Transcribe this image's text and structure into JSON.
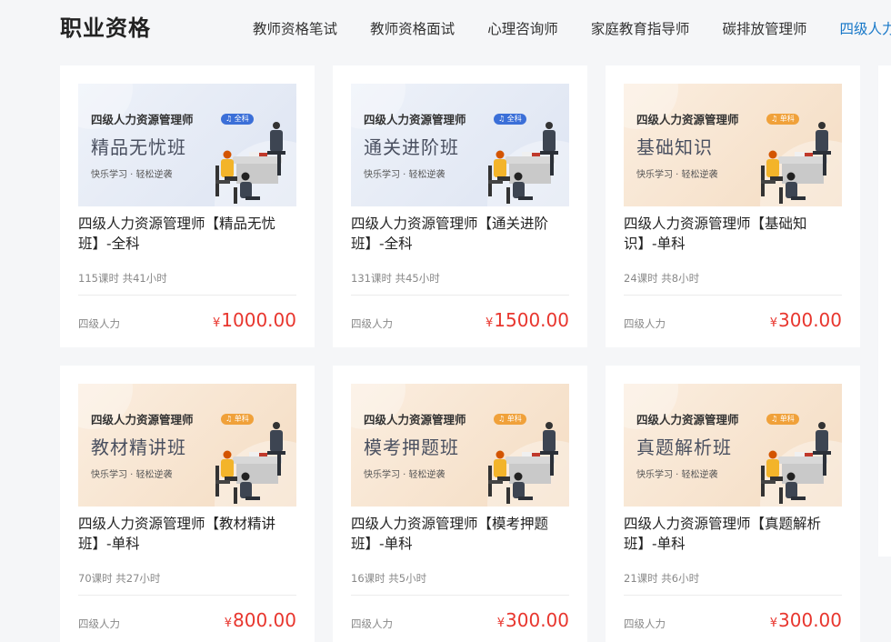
{
  "header": {
    "title": "职业资格",
    "tabs": [
      {
        "label": "教师资格笔试",
        "active": false
      },
      {
        "label": "教师资格面试",
        "active": false
      },
      {
        "label": "心理咨询师",
        "active": false
      },
      {
        "label": "家庭教育指导师",
        "active": false
      },
      {
        "label": "碳排放管理师",
        "active": false
      },
      {
        "label": "四级人力",
        "active": true
      }
    ]
  },
  "colors": {
    "accent": "#1677c8",
    "price": "#e8362e",
    "tag_full": "#3b6fd8",
    "tag_single": "#f0a13a"
  },
  "currency_symbol": "¥",
  "courses": [
    {
      "thumb_brand": "四级人力资源管理师",
      "thumb_tag": "全科",
      "thumb_course": "精品无忧班",
      "thumb_slogan": "快乐学习 · 轻松逆袭",
      "theme": "blue",
      "title": "四级人力资源管理师【精品无忧班】-全科",
      "meta": "115课时 共41小时",
      "category": "四级人力",
      "price": "1000.00"
    },
    {
      "thumb_brand": "四级人力资源管理师",
      "thumb_tag": "全科",
      "thumb_course": "通关进阶班",
      "thumb_slogan": "快乐学习 · 轻松逆袭",
      "theme": "blue",
      "title": "四级人力资源管理师【通关进阶班】-全科",
      "meta": "131课时 共45小时",
      "category": "四级人力",
      "price": "1500.00"
    },
    {
      "thumb_brand": "四级人力资源管理师",
      "thumb_tag": "单科",
      "thumb_course": "基础知识",
      "thumb_slogan": "快乐学习 · 轻松逆袭",
      "theme": "warm",
      "title": "四级人力资源管理师【基础知识】-单科",
      "meta": "24课时 共8小时",
      "category": "四级人力",
      "price": "300.00"
    },
    {
      "thumb_brand": "四级人力资源管理师",
      "thumb_tag": "单科",
      "thumb_course": "教材精讲班",
      "thumb_slogan": "快乐学习 · 轻松逆袭",
      "theme": "warm",
      "title": "四级人力资源管理师【教材精讲班】-单科",
      "meta": "70课时 共27小时",
      "category": "四级人力",
      "price": "800.00"
    },
    {
      "thumb_brand": "四级人力资源管理师",
      "thumb_tag": "单科",
      "thumb_course": "模考押题班",
      "thumb_slogan": "快乐学习 · 轻松逆袭",
      "theme": "warm",
      "title": "四级人力资源管理师【模考押题班】-单科",
      "meta": "16课时 共5小时",
      "category": "四级人力",
      "price": "300.00"
    },
    {
      "thumb_brand": "四级人力资源管理师",
      "thumb_tag": "单科",
      "thumb_course": "真题解析班",
      "thumb_slogan": "快乐学习 · 轻松逆袭",
      "theme": "warm",
      "title": "四级人力资源管理师【真题解析班】-单科",
      "meta": "21课时 共6小时",
      "category": "四级人力",
      "price": "300.00"
    }
  ]
}
